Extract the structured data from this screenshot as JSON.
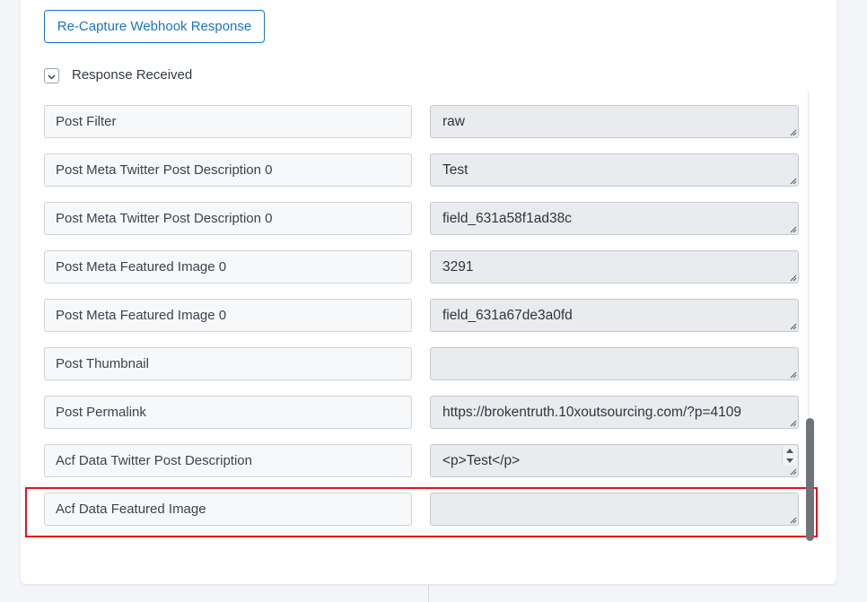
{
  "header": {
    "recapture_label": "Re-Capture Webhook Response",
    "response_received_label": "Response Received"
  },
  "fields": [
    {
      "key": "Post Filter",
      "value": "raw"
    },
    {
      "key": "Post Meta Twitter Post Description 0",
      "value": "Test"
    },
    {
      "key": "Post Meta  Twitter Post Description 0",
      "value": "field_631a58f1ad38c"
    },
    {
      "key": "Post Meta Featured Image 0",
      "value": "3291"
    },
    {
      "key": "Post Meta  Featured Image 0",
      "value": "field_631a67de3a0fd"
    },
    {
      "key": "Post Thumbnail",
      "value": ""
    },
    {
      "key": "Post Permalink",
      "value": "https://brokentruth.10xoutsourcing.com/?p=4109"
    },
    {
      "key": "Acf Data Twitter Post Description",
      "value": "<p>Test</p>"
    },
    {
      "key": "Acf Data Featured Image",
      "value": ""
    }
  ],
  "colors": {
    "accent": "#1a73c9",
    "highlight": "#e1141b"
  }
}
